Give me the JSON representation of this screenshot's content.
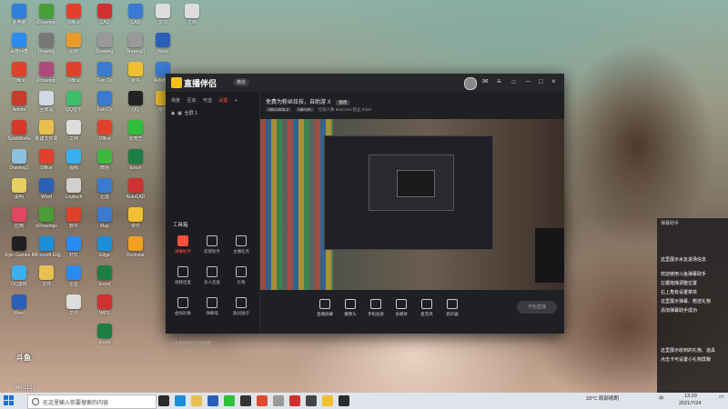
{
  "desktop": {
    "icons": [
      {
        "label": "此电脑",
        "color": "#2f7fd8"
      },
      {
        "label": "百度网盘",
        "color": "#2a8cf0"
      },
      {
        "label": "Office",
        "color": "#e0412b"
      },
      {
        "label": "Adobe",
        "color": "#c93b2a"
      },
      {
        "label": "SolidWorks",
        "color": "#d33a2c"
      },
      {
        "label": "Drawing1",
        "color": "#8ec0e0"
      },
      {
        "label": "说明",
        "color": "#e8d060"
      },
      {
        "label": "应用",
        "color": "#e04860"
      },
      {
        "label": "Epic Games Launcher",
        "color": "#202020"
      },
      {
        "label": "QQ游戏",
        "color": "#3ab0f0"
      },
      {
        "label": "Word",
        "color": "#2b5fb5"
      },
      {
        "label": "eDrawings",
        "color": "#4a9e3a"
      },
      {
        "label": "Drawing",
        "color": "#777"
      },
      {
        "label": "eDrawings",
        "color": "#b04a7a"
      },
      {
        "label": "回收站",
        "color": "#cfd8e3"
      },
      {
        "label": "新建文件夹",
        "color": "#e8c050"
      },
      {
        "label": "Office",
        "color": "#e0412b"
      },
      {
        "label": "Word",
        "color": "#2b5fb5"
      },
      {
        "label": "eDrawings",
        "color": "#4a9e3a"
      },
      {
        "label": "Microsoft Edge",
        "color": "#1b8fd8"
      },
      {
        "label": "文件",
        "color": "#e8c050"
      },
      {
        "label": "Office",
        "color": "#e0412b"
      },
      {
        "label": "图标",
        "color": "#e89a2a"
      },
      {
        "label": "Office",
        "color": "#e0412b"
      },
      {
        "label": "QQ音乐",
        "color": "#3cbf6a"
      },
      {
        "label": "文档",
        "color": "#ddd"
      },
      {
        "label": "视频",
        "color": "#3ab0f0"
      },
      {
        "label": "Logitech",
        "color": "#d0d0d0"
      },
      {
        "label": "软件",
        "color": "#e0412b"
      },
      {
        "label": "钉钉",
        "color": "#2a8cf0"
      },
      {
        "label": "迅雷",
        "color": "#2a8cf0"
      },
      {
        "label": "文件",
        "color": "#ddd"
      },
      {
        "label": "CAD",
        "color": "#d03030"
      },
      {
        "label": "Drawing",
        "color": "#999"
      },
      {
        "label": "Fan Cy",
        "color": "#3a7ad0"
      },
      {
        "label": "Fan Cy",
        "color": "#3a7ad0"
      },
      {
        "label": "Office",
        "color": "#e0412b"
      },
      {
        "label": "微信",
        "color": "#40b840"
      },
      {
        "label": "迅雷",
        "color": "#3a7ad0"
      },
      {
        "label": "Map",
        "color": "#3a7ad0"
      },
      {
        "label": "Edge",
        "color": "#1b8fd8"
      },
      {
        "label": "Excel",
        "color": "#1e7d45"
      },
      {
        "label": "WPS",
        "color": "#d03030"
      },
      {
        "label": "Excel",
        "color": "#1e7d45"
      },
      {
        "label": "CAD",
        "color": "#3a7ad0"
      },
      {
        "label": "Drawing1",
        "color": "#999"
      },
      {
        "label": "零件",
        "color": "#f0c030"
      },
      {
        "label": "QQ",
        "color": "#222"
      },
      {
        "label": "爱奇艺",
        "color": "#2fbf3a"
      },
      {
        "label": "Excel",
        "color": "#1e7d45"
      },
      {
        "label": "AutoCAD",
        "color": "#d03030"
      },
      {
        "label": "零件",
        "color": "#f0c030"
      },
      {
        "label": "Rockstar",
        "color": "#f0a020"
      },
      {
        "label": "文件",
        "color": "#ddd"
      },
      {
        "label": "Word",
        "color": "#2b5fb5"
      },
      {
        "label": "Autodesk",
        "color": "#3a7ad0"
      },
      {
        "label": "零件",
        "color": "#f0c030"
      },
      {
        "label": "文档",
        "color": "#ddd"
      }
    ]
  },
  "app": {
    "title": "直播伴侣",
    "version_badge": "微信",
    "left_tabs": [
      "场景",
      "互动",
      "可选",
      "设置"
    ],
    "active_tab_index": 3,
    "scene_label": "全屏 1",
    "toolbox_title": "工具箱",
    "tools": [
      {
        "label": "弹幕助手",
        "active": true
      },
      {
        "label": "房管助手",
        "active": false
      },
      {
        "label": "主播任务",
        "active": false
      },
      {
        "label": "视频连麦",
        "active": false
      },
      {
        "label": "多人连麦",
        "active": false
      },
      {
        "label": "礼物",
        "active": false
      },
      {
        "label": "虚拟形象",
        "active": false
      },
      {
        "label": "弹幕墙",
        "active": false
      },
      {
        "label": "歌词展示",
        "active": false
      }
    ],
    "notice": "5 条直播中的互动提醒",
    "stream_title": "免费为粉丝炫技，自助游 X",
    "stream_tag": "修改",
    "stream_chips": [
      "NBA2K0L2",
      "NBA2K"
    ],
    "stream_meta": "在线人数 9620193  粉丝 9329",
    "controls": [
      "直播屏幕",
      "摄像头",
      "手机投屏",
      "多媒体",
      "麦克风",
      "扬声器"
    ],
    "golive_label": "开始直播"
  },
  "chat_overlay": {
    "header": "弹幕助手",
    "lines": [
      "这里展示水友进场信息",
      "欢迎使用斗鱼弹幕助手",
      "左键拖拽调整位置",
      "右上角有设置菜单",
      "这里展示弹幕、赠送礼物",
      "添加弹幕助手成功",
      "这里展示收到的礼物、道具",
      "点击卡可设置小礼物屏蔽"
    ]
  },
  "watermark": {
    "logo": "斗鱼",
    "room_number": "9601193"
  },
  "taskbar": {
    "search_placeholder": "在这里输入你要搜索的内容",
    "weather": "33°C 局部晴朗",
    "time": "13:29",
    "date": "2021/7/24",
    "language": "中",
    "app_colors": [
      "#2a2a2a",
      "#1b8fd8",
      "#e8c050",
      "#2b5fb5",
      "#2fbf3a",
      "#333",
      "#e04830",
      "#999",
      "#d03030",
      "#444",
      "#f0c030",
      "#2a2a2a"
    ]
  }
}
